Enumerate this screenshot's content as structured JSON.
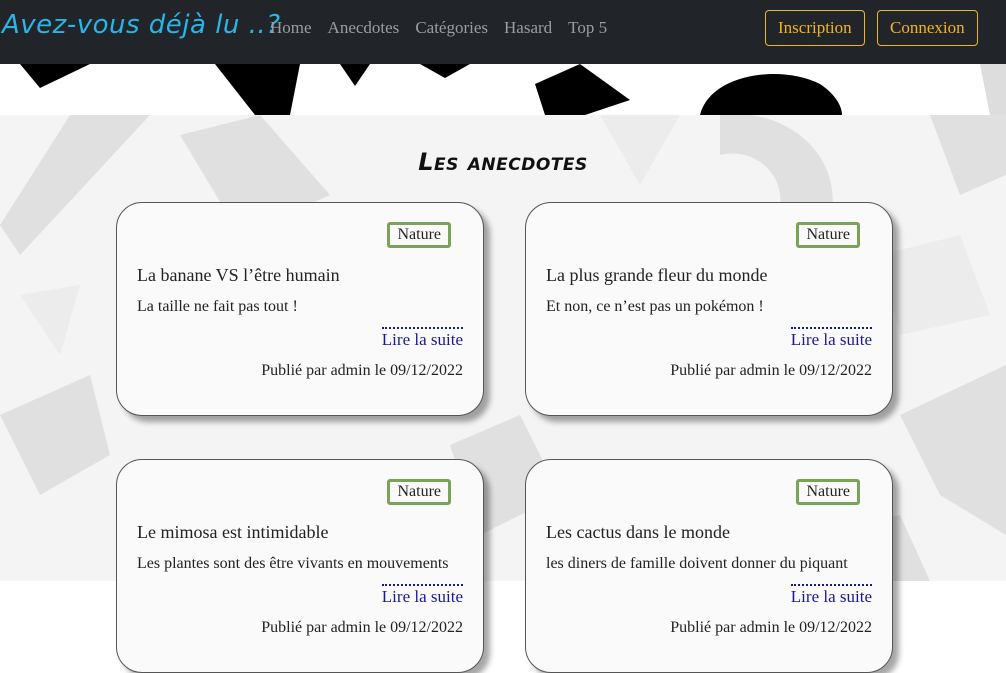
{
  "navbar": {
    "brand": "Avez-vous déjà lu ..?",
    "links": [
      "Home",
      "Anecdotes",
      "Catégories",
      "Hasard",
      "Top 5"
    ],
    "signup_label": "Inscription",
    "login_label": "Connexion"
  },
  "section_title": "Les anecdotes",
  "cards": [
    {
      "category": "Nature",
      "title": "La banane VS l’être humain",
      "text": "La taille ne fait pas tout !",
      "link": "Lire la suite",
      "meta": "Publié par admin le 09/12/2022"
    },
    {
      "category": "Nature",
      "title": "La plus grande fleur du monde",
      "text": "Et non, ce n’est pas un pokémon !",
      "link": "Lire la suite",
      "meta": "Publié par admin le 09/12/2022"
    },
    {
      "category": "Nature",
      "title": "Le mimosa est intimidable",
      "text": "Les plantes sont des être vivants en mouvements",
      "link": "Lire la suite",
      "meta": "Publié par admin le 09/12/2022"
    },
    {
      "category": "Nature",
      "title": "Les cactus dans le monde",
      "text": "les diners de famille doivent donner du piquant",
      "link": "Lire la suite",
      "meta": "Publié par admin le 09/12/2022"
    }
  ],
  "colors": {
    "navbar_bg": "#212529",
    "brand": "#29b6e6",
    "nav_button": "#f0b429",
    "badge_border": "#7aa35a",
    "link": "#1a1a8f"
  }
}
